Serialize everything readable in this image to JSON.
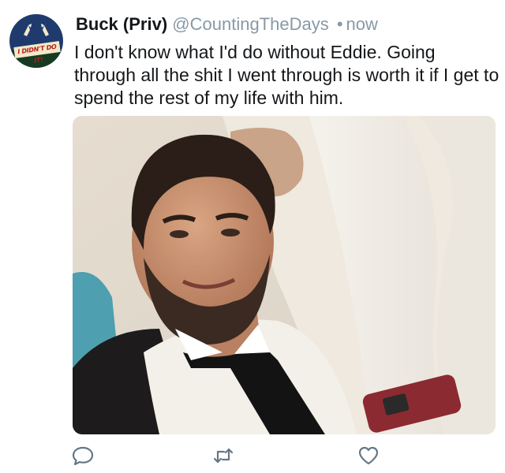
{
  "tweet": {
    "author_name": "Buck (Priv)",
    "handle": "@CountingTheDays",
    "separator": "•",
    "timestamp": "now",
    "text": "I don't know what I'd do without Eddie. Going through all the shit I went through is worth it if I get to spend the rest of my life with him.",
    "avatar_banner_text": "I DIDN'T DO IT!"
  },
  "actions": {
    "reply_icon": "speech-bubble-icon",
    "retweet_icon": "retweet-arrows-icon",
    "like_icon": "heart-icon"
  },
  "colors": {
    "text": "#14171a",
    "secondary": "#8899a6",
    "icon": "#657786"
  }
}
